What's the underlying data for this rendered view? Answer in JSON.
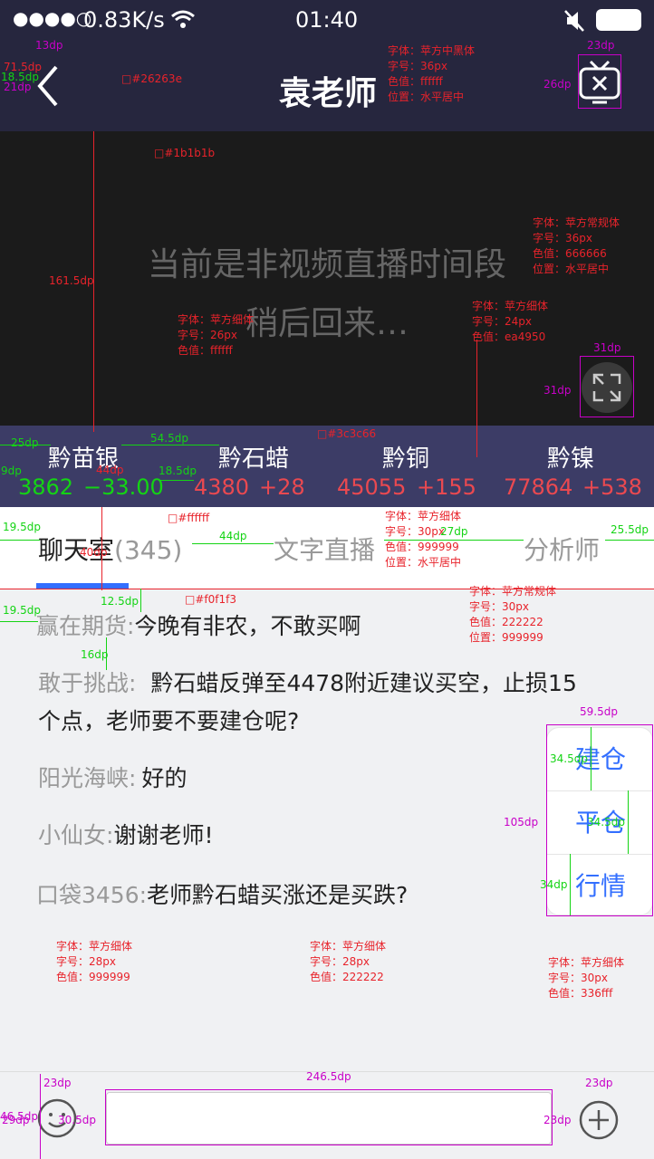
{
  "status": {
    "signal": "●●●●○",
    "speed": "0.83K/s",
    "time": "01:40"
  },
  "nav": {
    "title": "袁老师",
    "back_icon": "chevron-left-icon",
    "tv_icon": "tv-close-icon"
  },
  "video": {
    "line1": "当前是非视频直播时间段",
    "line2": "稍后回来…",
    "fullscreen_icon": "expand-icon"
  },
  "prices": [
    {
      "name": "黔苗银",
      "value": "3862",
      "change": "−33.00",
      "color": "#14d414"
    },
    {
      "name": "黔石蜡",
      "value": "4380",
      "change": "+28",
      "color": "#ea4950"
    },
    {
      "name": "黔铜",
      "value": "45055",
      "change": "+155",
      "color": "#ea4950"
    },
    {
      "name": "黔镍",
      "value": "77864",
      "change": "+538",
      "color": "#ea4950"
    }
  ],
  "tabs": [
    {
      "label": "聊天室",
      "count": "(345)"
    },
    {
      "label": "文字直播"
    },
    {
      "label": "分析师"
    }
  ],
  "chat": [
    {
      "name": "赢在期货:",
      "msg": "今晚有非农，不敢买啊"
    },
    {
      "name": "敢于挑战:",
      "msg": "黔石蜡反弹至4478附近建议买空，止损15"
    },
    {
      "name": "",
      "msg": "个点，老师要不要建仓呢?"
    },
    {
      "name": "阳光海峡:",
      "msg": "好的"
    },
    {
      "name": "小仙女:",
      "msg": "谢谢老师!"
    },
    {
      "name": "口袋3456:",
      "msg": "老师黔石蜡买涨还是买跌?"
    }
  ],
  "side_buttons": [
    "建仓",
    "平仓",
    "行情"
  ],
  "bottom": {
    "emoji_icon": "emoji-icon",
    "add_icon": "plus-icon",
    "input_value": ""
  },
  "annotations": {
    "nav_title": "字体：苹方中黑体\n字号：36px\n色值：ffffff\n位置：水平居中",
    "nav_bg": "□#26263e",
    "video_bg": "□#1b1b1b",
    "video_text": "字体：苹方常规体\n字号：36px\n色值：666666\n位置：水平居中",
    "price_name": "字体：苹方细体\n字号：26px\n色值：ffffff",
    "price_val": "字体：苹方细体\n字号：24px\n色值：ea4950",
    "price_bg": "□#3c3c66",
    "tab_bg": "□#ffffff",
    "tab_font": "字体：苹方细体\n字号：30px\n色值：999999\n位置：水平居中",
    "tab_active": "字体：苹方常规体\n字号：30px\n色值：222222\n位置：999999",
    "chat_bg": "□#f0f1f3",
    "chat_name": "字体：苹方细体\n字号：28px\n色值：999999",
    "chat_msg": "字体：苹方细体\n字号：28px\n色值：222222",
    "side_btn": "字体：苹方细体\n字号：30px\n色值：336fff",
    "dims": [
      "13dp",
      "71.5dp",
      "18.5dp",
      "21dp",
      "23dp",
      "26dp",
      "161.5dp",
      "31dp",
      "31dp",
      "25dp",
      "54.5dp",
      "9dp",
      "44dp",
      "18.5dp",
      "19.5dp",
      "44dp",
      "27dp",
      "25.5dp",
      "40dp",
      "12.5dp",
      "19.5dp",
      "16dp",
      "59.5dp",
      "34.5dp",
      "105dp",
      "34.5dp",
      "34dp",
      "246.5dp",
      "23dp",
      "23dp",
      "46.5dp",
      "29dp",
      "30.5dp",
      "23dp"
    ]
  }
}
